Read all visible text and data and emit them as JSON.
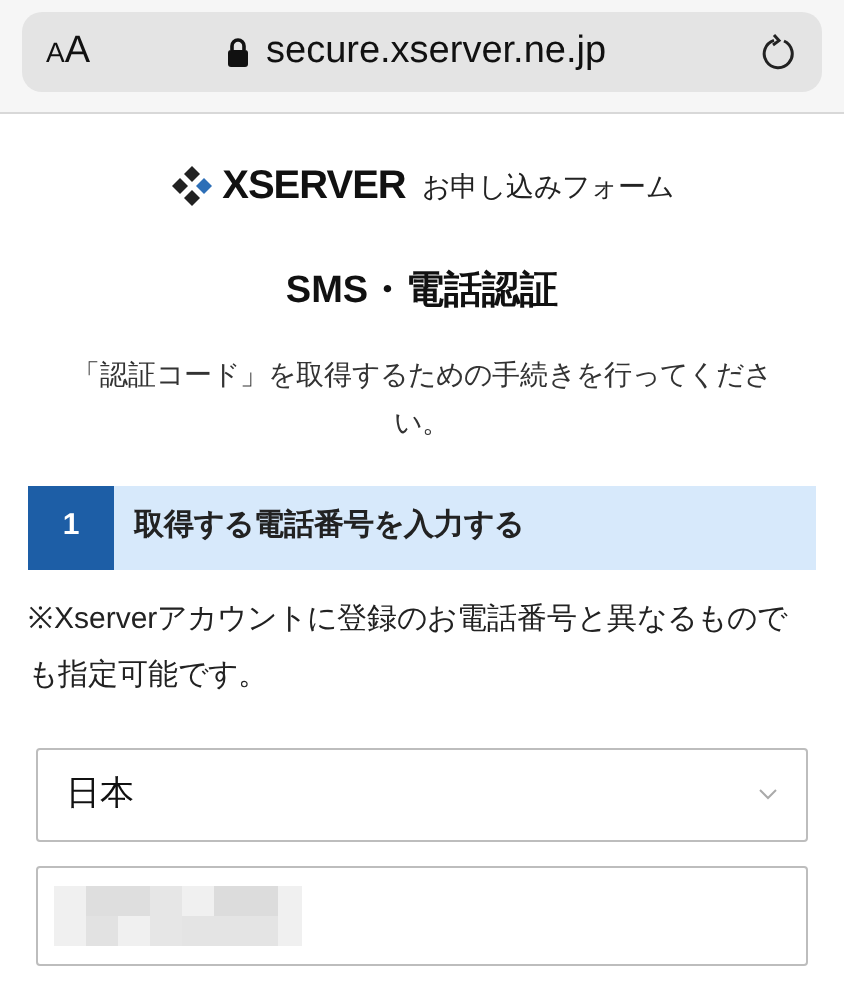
{
  "browser": {
    "text_size_button": "AA",
    "url": "secure.xserver.ne.jp"
  },
  "header": {
    "logo_text": "XSERVER",
    "form_name": "お申し込みフォーム"
  },
  "title": "SMS・電話認証",
  "description": "「認証コード」を取得するための手続きを行ってください。",
  "step": {
    "number": "1",
    "label": "取得する電話番号を入力する"
  },
  "note": "※Xserverアカウントに登録のお電話番号と異なるものでも指定可能です。",
  "country_select": {
    "value": "日本"
  }
}
